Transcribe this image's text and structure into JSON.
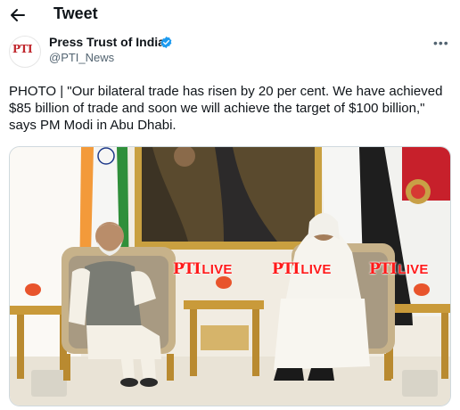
{
  "header": {
    "title": "Tweet",
    "back_icon": "arrow-left-icon"
  },
  "author": {
    "name": "Press Trust of India",
    "handle": "@PTI_News",
    "avatar_logo": "PTI",
    "verified_color": "#1d9bf0"
  },
  "tweet": {
    "text": "PHOTO | \"Our bilateral trade has risen by 20 per cent. We have achieved $85 billion of trade and soon we will achieve the target of $100 billion,\" says PM Modi in Abu Dhabi."
  },
  "media": {
    "watermarks": [
      {
        "logo": "PTI",
        "label": "LIVE"
      },
      {
        "logo": "PTI",
        "label": "LIVE"
      },
      {
        "logo": "PTI",
        "label": "LIVE"
      }
    ]
  }
}
